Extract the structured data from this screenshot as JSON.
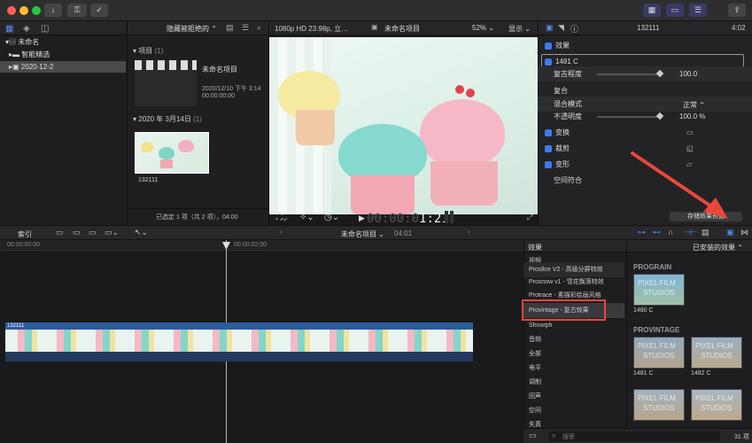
{
  "toolbar": {
    "red": "#ff5f57",
    "yellow": "#febc2e",
    "green": "#28c840",
    "import_icon": "download-arrow",
    "keys_icon": "key-icon",
    "check_icon": "checkmark-circle",
    "layout_icons": [
      "browser-layout-icon",
      "timeline-layout-icon",
      "inspector-layout-icon"
    ],
    "share_icon": "share-icon"
  },
  "library": {
    "items": [
      {
        "label": "未命名",
        "expanded": true
      },
      {
        "label": "智能精选"
      },
      {
        "label": "2020-12-2",
        "selected": true
      }
    ]
  },
  "browser": {
    "filter_label": "隐藏被拒绝的",
    "section_project": "项目",
    "project_count": "(1)",
    "project_name": "未命名项目",
    "project_date": "2020/12/10 下午 3:14",
    "project_duration": "00:00:00:00",
    "section_date": "2020 年 3月14日",
    "date_count": "(1)",
    "clip_name": "132111",
    "status": "已选定 1 项（共 2 项），04:00"
  },
  "viewer": {
    "format": "1080p HD 23.98p, 立…",
    "project_name": "未命名项目",
    "zoom": "52%",
    "display_label": "显示",
    "timecode_prefix": "00:00:0",
    "timecode_main": "1:21"
  },
  "inspector": {
    "clip_name": "132111",
    "duration": "4:02",
    "effects_label": "效果",
    "effect_name": "1481 C",
    "retro_label": "复古程度",
    "retro_value": "100.0",
    "retro_level": 1.0,
    "composite_label": "复合",
    "blend_label": "混合模式",
    "blend_value": "正常",
    "opacity_label": "不透明度",
    "opacity_value": "100.0",
    "opacity_unit": "%",
    "transform_label": "变换",
    "crop_label": "裁剪",
    "distort_label": "变形",
    "spatial_label": "空间符合",
    "save_preset": "存储效果预置"
  },
  "timeline": {
    "index_label": "索引",
    "project_name": "未命名项目",
    "duration": "04:01",
    "tc_start": "00:00:00:00",
    "tc_mid": "00:00:02:00",
    "clip_label": "132111"
  },
  "effects_browser": {
    "title": "效果",
    "installed_label": "已安装的效果",
    "categories": [
      {
        "label": "视频"
      },
      {
        "label": "Prosllce V2 - 高级分屏特效"
      },
      {
        "label": "Prosnow v1 - 雪花飘落特效"
      },
      {
        "label": "Protrace - 素描彩绘画风格"
      },
      {
        "label": "Provintage - 复古效果",
        "highlighted": true
      },
      {
        "label": "Shnorph"
      },
      {
        "label": "音频"
      },
      {
        "label": "全部"
      },
      {
        "label": "电平"
      },
      {
        "label": "调制"
      },
      {
        "label": "回声"
      },
      {
        "label": "空间"
      },
      {
        "label": "失真"
      }
    ],
    "group1": "PROGRAIN",
    "group2": "PROVINTAGE",
    "tiles": [
      {
        "name": "1480 C",
        "wm1": "PIXEL FILM",
        "wm2": "STUDIOS"
      },
      {
        "name": "1481 C",
        "wm1": "PIXEL FILM",
        "wm2": "STUDIOS"
      },
      {
        "name": "1482 C",
        "wm1": "PIXEL FILM",
        "wm2": "STUDIOS"
      },
      {
        "name": "",
        "wm1": "PIXEL FILM",
        "wm2": "STUDIOS"
      },
      {
        "name": "",
        "wm1": "PIXEL FILM",
        "wm2": "STUDIOS"
      }
    ],
    "search_placeholder": "搜索",
    "count": "31 项"
  },
  "annotation": {
    "arrow_color": "#e8473c",
    "box_color": "#e8473c"
  }
}
